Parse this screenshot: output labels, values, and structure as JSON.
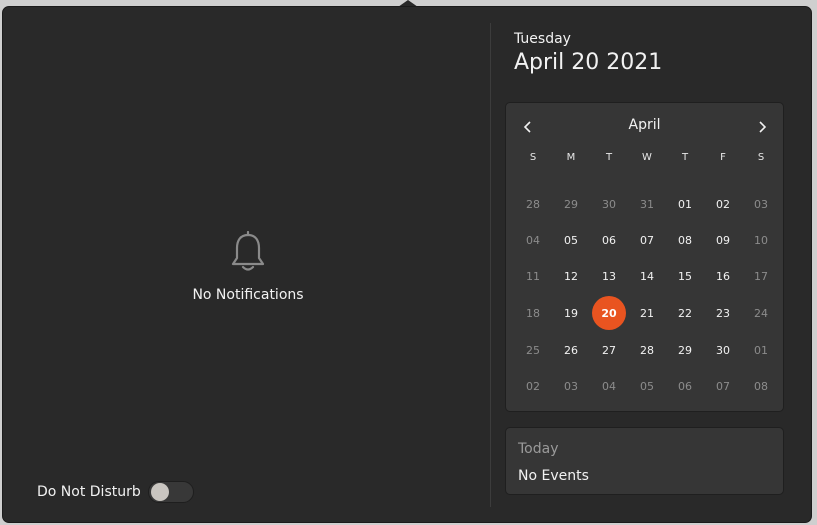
{
  "notifications": {
    "empty_text": "No Notifications",
    "bell_icon": "bell-icon"
  },
  "do_not_disturb": {
    "label": "Do Not Disturb",
    "enabled": false
  },
  "date_header": {
    "weekday": "Tuesday",
    "date": "April 20 2021"
  },
  "calendar": {
    "month": "April",
    "prev_icon": "chevron-left-icon",
    "next_icon": "chevron-right-icon",
    "weekdays": [
      "S",
      "M",
      "T",
      "W",
      "T",
      "F",
      "S"
    ],
    "weeks": [
      [
        {
          "d": "28",
          "o": true
        },
        {
          "d": "29",
          "o": true
        },
        {
          "d": "30",
          "o": true
        },
        {
          "d": "31",
          "o": true
        },
        {
          "d": "01",
          "o": false
        },
        {
          "d": "02",
          "o": false
        },
        {
          "d": "03",
          "o": true
        }
      ],
      [
        {
          "d": "04",
          "o": true
        },
        {
          "d": "05",
          "o": false
        },
        {
          "d": "06",
          "o": false
        },
        {
          "d": "07",
          "o": false
        },
        {
          "d": "08",
          "o": false
        },
        {
          "d": "09",
          "o": false
        },
        {
          "d": "10",
          "o": true
        }
      ],
      [
        {
          "d": "11",
          "o": true
        },
        {
          "d": "12",
          "o": false
        },
        {
          "d": "13",
          "o": false
        },
        {
          "d": "14",
          "o": false
        },
        {
          "d": "15",
          "o": false
        },
        {
          "d": "16",
          "o": false
        },
        {
          "d": "17",
          "o": true
        }
      ],
      [
        {
          "d": "18",
          "o": true
        },
        {
          "d": "19",
          "o": false
        },
        {
          "d": "20",
          "o": false,
          "today": true
        },
        {
          "d": "21",
          "o": false
        },
        {
          "d": "22",
          "o": false
        },
        {
          "d": "23",
          "o": false
        },
        {
          "d": "24",
          "o": true
        }
      ],
      [
        {
          "d": "25",
          "o": true
        },
        {
          "d": "26",
          "o": false
        },
        {
          "d": "27",
          "o": false
        },
        {
          "d": "28",
          "o": false
        },
        {
          "d": "29",
          "o": false
        },
        {
          "d": "30",
          "o": false
        },
        {
          "d": "01",
          "o": true
        }
      ],
      [
        {
          "d": "02",
          "o": true
        },
        {
          "d": "03",
          "o": true
        },
        {
          "d": "04",
          "o": true
        },
        {
          "d": "05",
          "o": true
        },
        {
          "d": "06",
          "o": true
        },
        {
          "d": "07",
          "o": true
        },
        {
          "d": "08",
          "o": true
        }
      ]
    ]
  },
  "events": {
    "heading": "Today",
    "empty_text": "No Events"
  },
  "colors": {
    "accent": "#e95420",
    "background": "#292929",
    "panel": "#363636"
  }
}
